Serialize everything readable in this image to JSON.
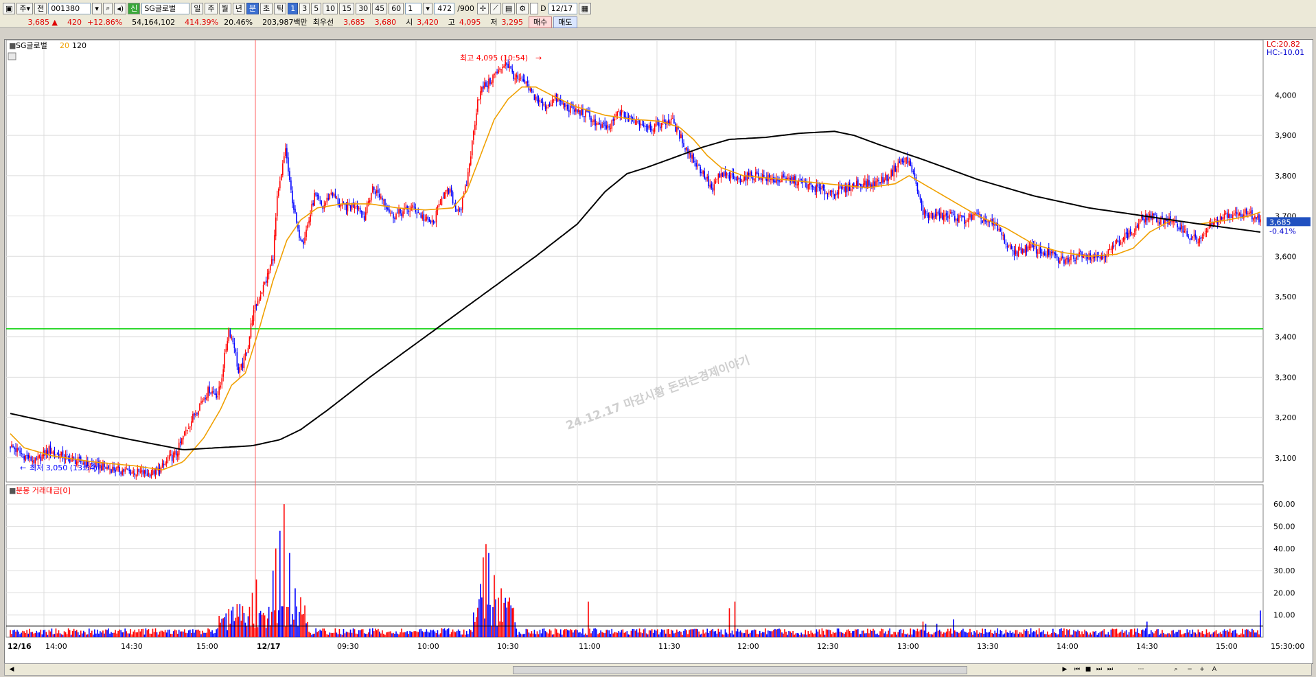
{
  "toolbar": {
    "mode_label": "주",
    "market_label": "전",
    "code": "001380",
    "stock_name": "SG글로벌",
    "badge_credit": "신",
    "periods": [
      "일",
      "주",
      "월",
      "년"
    ],
    "period_minute": "분",
    "period_second": "초",
    "period_tick": "틱",
    "minute_options": [
      "1",
      "3",
      "5",
      "10",
      "15",
      "30",
      "45",
      "60"
    ],
    "active_minute": "1",
    "multiplier": "1",
    "count_shown": "472",
    "count_total": "/900",
    "d_label": "D",
    "date_value": "12/17"
  },
  "quote": {
    "price": "3,685",
    "change": "420",
    "change_pct": "+12.86%",
    "volume": "54,164,102",
    "volume_ratio": "414.39%",
    "turnover": "20.46%",
    "amount": "203,987백만",
    "best_label": "최우선",
    "best_ask": "3,685",
    "best_bid": "3,680",
    "open_label": "시",
    "open": "3,420",
    "high_label": "고",
    "high": "4,095",
    "low_label": "저",
    "low": "3,295",
    "buy_label": "매수",
    "sell_label": "매도"
  },
  "colors": {
    "up": "#ff0000",
    "down": "#0000ff",
    "ma20": "#f0a000",
    "ma120": "#000000",
    "level_line": "#00d000",
    "vline": "#ff6060"
  },
  "chart_data": [
    {
      "type": "candlestick",
      "legend": [
        "SG글로벌",
        "20",
        "120"
      ],
      "ylim": [
        3040,
        4120
      ],
      "y_ticks": [
        "3,100",
        "3,200",
        "3,300",
        "3,400",
        "3,500",
        "3,600",
        "3,700",
        "3,800",
        "3,900",
        "4,000"
      ],
      "x_ticks": [
        "12/16",
        "14:00",
        "14:30",
        "15:00",
        "12/17",
        "09:30",
        "10:00",
        "10:30",
        "11:00",
        "11:30",
        "12:00",
        "12:30",
        "13:00",
        "13:30",
        "14:00",
        "14:30",
        "15:00",
        "15:30:00"
      ],
      "lc_label": "LC:20.82",
      "hc_label": "HC:-10.01",
      "current_price_tag": "3,685",
      "current_pct_tag": "-0.41%",
      "high_annotation": "최고 4,095 (10:54)",
      "low_annotation": "최저 3,050 (13:54)",
      "watermark": "24.12.17 마감시황 돈되는경제이야기",
      "level_line": 3420,
      "price_anchors": [
        [
          0,
          3130
        ],
        [
          8,
          3110
        ],
        [
          18,
          3090
        ],
        [
          28,
          3120
        ],
        [
          40,
          3100
        ],
        [
          55,
          3085
        ],
        [
          70,
          3075
        ],
        [
          88,
          3065
        ],
        [
          100,
          3060
        ],
        [
          108,
          3070
        ],
        [
          116,
          3100
        ],
        [
          120,
          3110
        ],
        [
          126,
          3160
        ],
        [
          132,
          3200
        ],
        [
          138,
          3240
        ],
        [
          144,
          3270
        ],
        [
          150,
          3255
        ],
        [
          152,
          3280
        ],
        [
          158,
          3420
        ],
        [
          162,
          3380
        ],
        [
          165,
          3310
        ],
        [
          168,
          3330
        ],
        [
          172,
          3380
        ],
        [
          175,
          3450
        ],
        [
          180,
          3500
        ],
        [
          185,
          3540
        ],
        [
          190,
          3600
        ],
        [
          193,
          3740
        ],
        [
          196,
          3800
        ],
        [
          199,
          3870
        ],
        [
          202,
          3780
        ],
        [
          205,
          3720
        ],
        [
          208,
          3660
        ],
        [
          212,
          3640
        ],
        [
          216,
          3690
        ],
        [
          220,
          3750
        ],
        [
          226,
          3720
        ],
        [
          232,
          3760
        ],
        [
          240,
          3720
        ],
        [
          250,
          3730
        ],
        [
          256,
          3700
        ],
        [
          262,
          3770
        ],
        [
          270,
          3740
        ],
        [
          276,
          3700
        ],
        [
          284,
          3710
        ],
        [
          292,
          3720
        ],
        [
          300,
          3690
        ],
        [
          306,
          3680
        ],
        [
          312,
          3750
        ],
        [
          318,
          3760
        ],
        [
          322,
          3720
        ],
        [
          326,
          3720
        ],
        [
          330,
          3780
        ],
        [
          334,
          3880
        ],
        [
          338,
          3990
        ],
        [
          342,
          4020
        ],
        [
          346,
          4030
        ],
        [
          350,
          4050
        ],
        [
          354,
          4060
        ],
        [
          358,
          4085
        ],
        [
          362,
          4060
        ],
        [
          366,
          4040
        ],
        [
          372,
          4030
        ],
        [
          378,
          4000
        ],
        [
          386,
          3970
        ],
        [
          394,
          3990
        ],
        [
          402,
          3970
        ],
        [
          410,
          3960
        ],
        [
          418,
          3950
        ],
        [
          426,
          3920
        ],
        [
          434,
          3920
        ],
        [
          440,
          3960
        ],
        [
          448,
          3940
        ],
        [
          456,
          3930
        ],
        [
          464,
          3920
        ],
        [
          472,
          3930
        ],
        [
          478,
          3940
        ],
        [
          484,
          3900
        ],
        [
          490,
          3860
        ],
        [
          496,
          3830
        ],
        [
          502,
          3800
        ],
        [
          508,
          3760
        ],
        [
          512,
          3800
        ],
        [
          518,
          3800
        ],
        [
          526,
          3790
        ],
        [
          534,
          3800
        ],
        [
          542,
          3800
        ],
        [
          550,
          3790
        ],
        [
          558,
          3790
        ],
        [
          566,
          3790
        ],
        [
          574,
          3780
        ],
        [
          582,
          3770
        ],
        [
          590,
          3760
        ],
        [
          598,
          3760
        ],
        [
          606,
          3770
        ],
        [
          612,
          3780
        ],
        [
          618,
          3780
        ],
        [
          624,
          3780
        ],
        [
          630,
          3790
        ],
        [
          636,
          3800
        ],
        [
          642,
          3830
        ],
        [
          648,
          3840
        ],
        [
          652,
          3820
        ],
        [
          656,
          3760
        ],
        [
          660,
          3710
        ],
        [
          666,
          3700
        ],
        [
          674,
          3700
        ],
        [
          682,
          3700
        ],
        [
          690,
          3690
        ],
        [
          698,
          3700
        ],
        [
          704,
          3690
        ],
        [
          710,
          3680
        ],
        [
          716,
          3660
        ],
        [
          722,
          3620
        ],
        [
          728,
          3610
        ],
        [
          734,
          3620
        ],
        [
          740,
          3620
        ],
        [
          746,
          3610
        ],
        [
          752,
          3610
        ],
        [
          758,
          3590
        ],
        [
          764,
          3590
        ],
        [
          770,
          3600
        ],
        [
          776,
          3610
        ],
        [
          782,
          3600
        ],
        [
          788,
          3600
        ],
        [
          794,
          3610
        ],
        [
          800,
          3630
        ],
        [
          806,
          3650
        ],
        [
          812,
          3660
        ],
        [
          818,
          3690
        ],
        [
          824,
          3700
        ],
        [
          830,
          3690
        ],
        [
          836,
          3690
        ],
        [
          842,
          3680
        ],
        [
          848,
          3670
        ],
        [
          852,
          3650
        ],
        [
          858,
          3640
        ],
        [
          864,
          3650
        ],
        [
          868,
          3680
        ],
        [
          874,
          3690
        ],
        [
          880,
          3700
        ],
        [
          886,
          3700
        ],
        [
          892,
          3710
        ],
        [
          898,
          3700
        ],
        [
          904,
          3690
        ]
      ],
      "ma20_anchors": [
        [
          0,
          3160
        ],
        [
          10,
          3125
        ],
        [
          30,
          3105
        ],
        [
          60,
          3090
        ],
        [
          90,
          3080
        ],
        [
          110,
          3070
        ],
        [
          125,
          3090
        ],
        [
          140,
          3150
        ],
        [
          152,
          3220
        ],
        [
          160,
          3280
        ],
        [
          170,
          3310
        ],
        [
          180,
          3420
        ],
        [
          190,
          3540
        ],
        [
          200,
          3640
        ],
        [
          210,
          3690
        ],
        [
          222,
          3720
        ],
        [
          240,
          3730
        ],
        [
          260,
          3730
        ],
        [
          280,
          3720
        ],
        [
          300,
          3715
        ],
        [
          320,
          3720
        ],
        [
          330,
          3760
        ],
        [
          340,
          3850
        ],
        [
          350,
          3940
        ],
        [
          360,
          3990
        ],
        [
          370,
          4020
        ],
        [
          380,
          4020
        ],
        [
          394,
          3995
        ],
        [
          410,
          3970
        ],
        [
          430,
          3950
        ],
        [
          450,
          3940
        ],
        [
          470,
          3935
        ],
        [
          484,
          3920
        ],
        [
          494,
          3890
        ],
        [
          504,
          3850
        ],
        [
          514,
          3820
        ],
        [
          530,
          3800
        ],
        [
          560,
          3790
        ],
        [
          590,
          3780
        ],
        [
          620,
          3770
        ],
        [
          640,
          3780
        ],
        [
          650,
          3800
        ],
        [
          660,
          3780
        ],
        [
          680,
          3740
        ],
        [
          700,
          3700
        ],
        [
          720,
          3670
        ],
        [
          740,
          3630
        ],
        [
          760,
          3610
        ],
        [
          780,
          3600
        ],
        [
          800,
          3605
        ],
        [
          812,
          3620
        ],
        [
          824,
          3660
        ],
        [
          840,
          3690
        ],
        [
          860,
          3680
        ],
        [
          880,
          3690
        ],
        [
          896,
          3700
        ],
        [
          904,
          3710
        ]
      ],
      "ma120_anchors": [
        [
          0,
          3210
        ],
        [
          40,
          3180
        ],
        [
          80,
          3150
        ],
        [
          110,
          3130
        ],
        [
          125,
          3120
        ],
        [
          150,
          3125
        ],
        [
          175,
          3130
        ],
        [
          195,
          3145
        ],
        [
          210,
          3170
        ],
        [
          230,
          3220
        ],
        [
          260,
          3300
        ],
        [
          300,
          3400
        ],
        [
          340,
          3500
        ],
        [
          380,
          3600
        ],
        [
          410,
          3680
        ],
        [
          430,
          3760
        ],
        [
          446,
          3805
        ],
        [
          460,
          3820
        ],
        [
          480,
          3845
        ],
        [
          500,
          3870
        ],
        [
          520,
          3890
        ],
        [
          546,
          3895
        ],
        [
          570,
          3905
        ],
        [
          596,
          3910
        ],
        [
          610,
          3900
        ],
        [
          630,
          3875
        ],
        [
          660,
          3840
        ],
        [
          700,
          3790
        ],
        [
          740,
          3750
        ],
        [
          780,
          3720
        ],
        [
          820,
          3700
        ],
        [
          860,
          3680
        ],
        [
          904,
          3660
        ]
      ]
    },
    {
      "type": "bar",
      "title": "분봉 거래대금[0]",
      "ylim": [
        0,
        65
      ],
      "y_ticks": [
        "10.00",
        "20.00",
        "30.00",
        "40.00",
        "50.00",
        "60.00"
      ],
      "ref_line": 5,
      "spikes": [
        [
          155,
          9
        ],
        [
          160,
          12
        ],
        [
          175,
          20
        ],
        [
          178,
          26
        ],
        [
          190,
          30
        ],
        [
          192,
          40
        ],
        [
          195,
          48
        ],
        [
          198,
          60
        ],
        [
          202,
          38
        ],
        [
          206,
          22
        ],
        [
          210,
          18
        ],
        [
          340,
          24
        ],
        [
          342,
          36
        ],
        [
          344,
          42
        ],
        [
          346,
          38
        ],
        [
          350,
          28
        ],
        [
          355,
          22
        ],
        [
          360,
          16
        ],
        [
          418,
          16
        ],
        [
          520,
          13
        ],
        [
          524,
          16
        ],
        [
          660,
          7
        ],
        [
          662,
          6
        ],
        [
          670,
          6
        ],
        [
          682,
          8
        ],
        [
          822,
          7
        ],
        [
          904,
          12
        ]
      ]
    }
  ]
}
